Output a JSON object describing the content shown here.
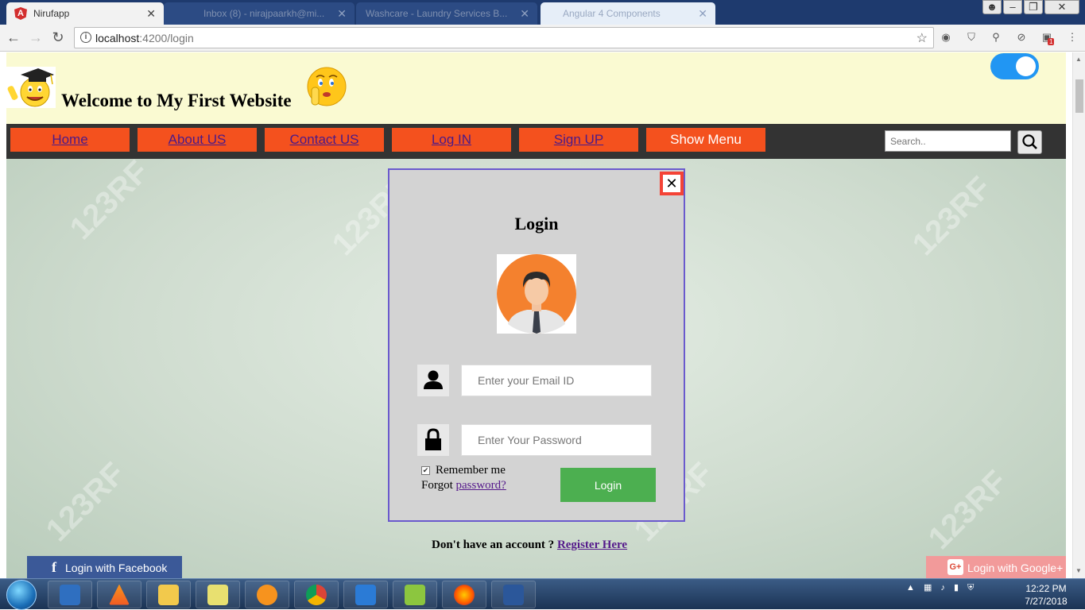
{
  "browser": {
    "tabs": [
      {
        "title": "Nirufapp",
        "active": true
      },
      {
        "title": "Inbox (8) - nirajpaarkh@mi...",
        "active": false
      },
      {
        "title": "Washcare - Laundry Services B...",
        "active": false
      },
      {
        "title": "Angular 4 Components",
        "active": false
      }
    ],
    "url_host": "localhost",
    "url_path": ":4200/login",
    "extension_badge": "1"
  },
  "header": {
    "site_title": "Welcome to My First Website"
  },
  "nav": {
    "items": [
      "Home",
      "About US",
      "Contact US",
      "Log IN",
      "Sign UP"
    ],
    "menu_button": "Show Menu",
    "search_placeholder": "Search.."
  },
  "modal": {
    "title": "Login",
    "close_symbol": "✕",
    "email_placeholder": "Enter your Email ID",
    "password_placeholder": "Enter Your Password",
    "remember_label": "Remember me",
    "remember_checked": true,
    "forgot_prefix": "Forgot ",
    "forgot_link": "password?",
    "login_button": "Login"
  },
  "register": {
    "prefix": "Don't have an account ? ",
    "link": "Register Here"
  },
  "social": {
    "facebook": "Login with Facebook",
    "google": "Login with Google+"
  },
  "watermark_text": "123RF",
  "taskbar": {
    "time": "12:22 PM",
    "date": "7/27/2018"
  },
  "colors": {
    "nav_button": "#f4511e",
    "navbar": "#333333",
    "header_bg": "#fafad2",
    "toggle": "#2196f3",
    "login_button": "#4caf50",
    "modal_border": "#6a5acd",
    "close_button": "#f44336",
    "facebook": "#3b5998",
    "google": "#f29a9a"
  }
}
